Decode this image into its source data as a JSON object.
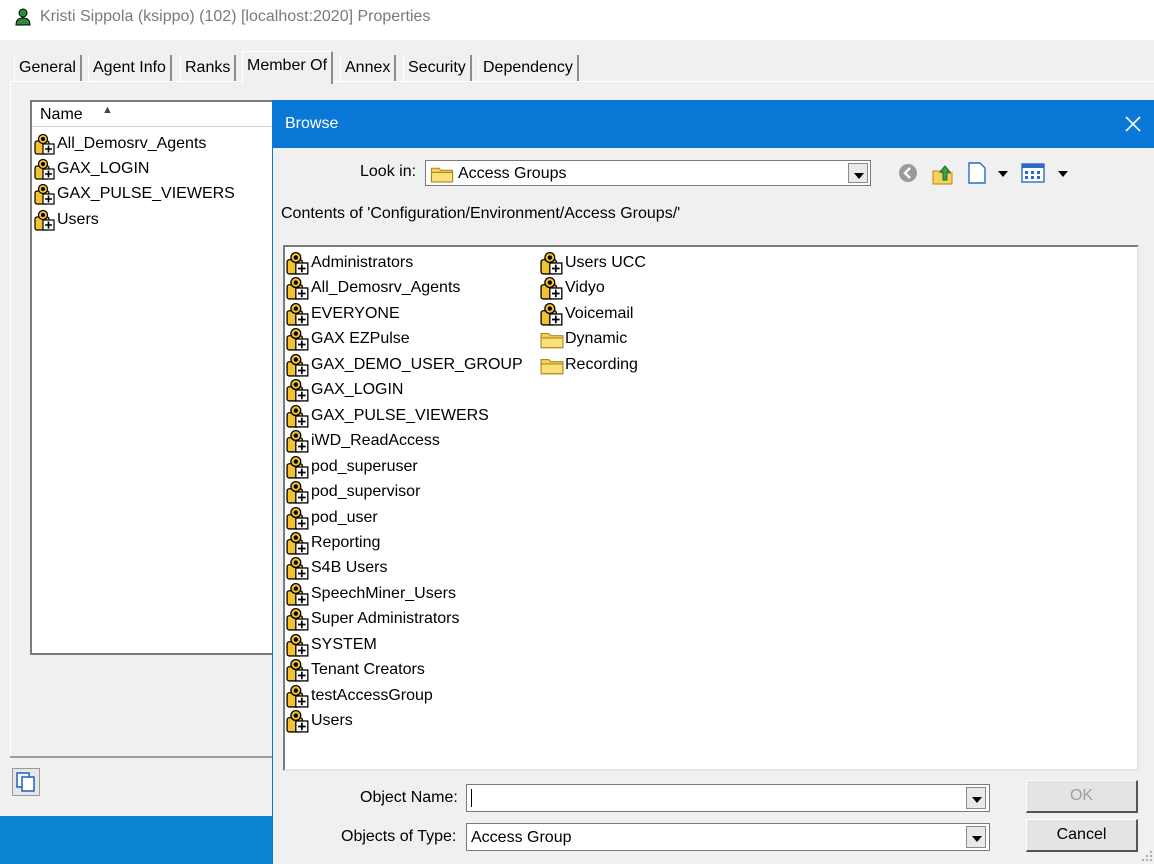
{
  "window": {
    "title": "Kristi Sippola (ksippo) (102) [localhost:2020] Properties",
    "icon": "user-icon"
  },
  "tabs": [
    {
      "label": "General"
    },
    {
      "label": "Agent Info"
    },
    {
      "label": "Ranks"
    },
    {
      "label": "Member Of",
      "active": true
    },
    {
      "label": "Annex"
    },
    {
      "label": "Security"
    },
    {
      "label": "Dependency"
    }
  ],
  "member_list": {
    "header": "Name",
    "items": [
      {
        "label": "All_Demosrv_Agents"
      },
      {
        "label": "GAX_LOGIN"
      },
      {
        "label": "GAX_PULSE_VIEWERS"
      },
      {
        "label": "Users"
      }
    ]
  },
  "dialog": {
    "title": "Browse",
    "look_in_label": "Look in:",
    "look_in_value": "Access Groups",
    "contents_label": "Contents of 'Configuration/Environment/Access Groups/'",
    "items_col1": [
      {
        "label": "Administrators",
        "icon": "access-group-icon"
      },
      {
        "label": "All_Demosrv_Agents",
        "icon": "access-group-icon"
      },
      {
        "label": "EVERYONE",
        "icon": "access-group-icon"
      },
      {
        "label": "GAX EZPulse",
        "icon": "access-group-icon"
      },
      {
        "label": "GAX_DEMO_USER_GROUP",
        "icon": "access-group-icon"
      },
      {
        "label": "GAX_LOGIN",
        "icon": "access-group-icon"
      },
      {
        "label": "GAX_PULSE_VIEWERS",
        "icon": "access-group-icon"
      },
      {
        "label": "iWD_ReadAccess",
        "icon": "access-group-icon"
      },
      {
        "label": "pod_superuser",
        "icon": "access-group-icon"
      },
      {
        "label": "pod_supervisor",
        "icon": "access-group-icon"
      },
      {
        "label": "pod_user",
        "icon": "access-group-icon"
      },
      {
        "label": "Reporting",
        "icon": "access-group-icon"
      },
      {
        "label": "S4B Users",
        "icon": "access-group-icon"
      },
      {
        "label": "SpeechMiner_Users",
        "icon": "access-group-icon"
      },
      {
        "label": "Super Administrators",
        "icon": "access-group-icon"
      },
      {
        "label": "SYSTEM",
        "icon": "access-group-icon"
      },
      {
        "label": "Tenant Creators",
        "icon": "access-group-icon"
      },
      {
        "label": "testAccessGroup",
        "icon": "access-group-icon"
      },
      {
        "label": "Users",
        "icon": "access-group-icon"
      }
    ],
    "items_col2": [
      {
        "label": "Users UCC",
        "icon": "access-group-icon"
      },
      {
        "label": "Vidyo",
        "icon": "access-group-icon"
      },
      {
        "label": "Voicemail",
        "icon": "access-group-icon"
      },
      {
        "label": "Dynamic",
        "icon": "folder-icon"
      },
      {
        "label": "Recording",
        "icon": "folder-icon"
      }
    ],
    "object_name_label": "Object Name:",
    "object_name_value": "",
    "objects_of_type_label": "Objects of Type:",
    "objects_of_type_value": "Access Group",
    "ok_label": "OK",
    "cancel_label": "Cancel"
  },
  "colors": {
    "dialog_title_bar": "#0a78d7",
    "taskbar_strip": "#0a84d0"
  }
}
